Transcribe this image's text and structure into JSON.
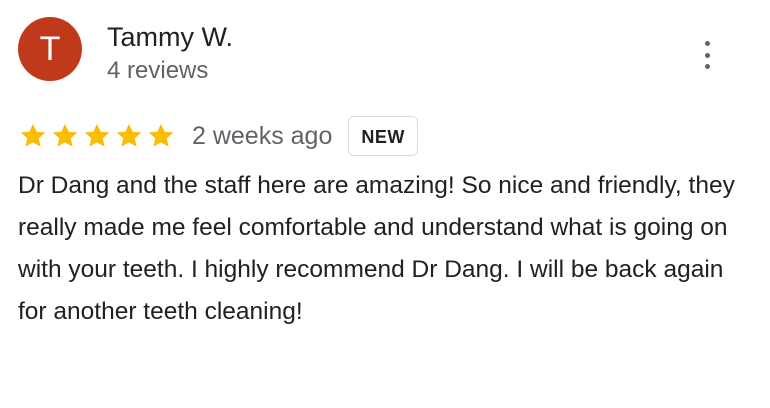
{
  "review": {
    "author": {
      "initial": "T",
      "name": "Tammy W.",
      "reviews_count": "4 reviews",
      "avatar_color": "#c0391b"
    },
    "rating": {
      "stars": 5,
      "max_stars": 5,
      "star_color": "#fbbc04"
    },
    "date": "2 weeks ago",
    "badge": "NEW",
    "text": "Dr Dang and the staff here are amazing! So nice and friendly, they really made me feel comfortable and understand what is going on with your teeth. I highly recommend Dr Dang. I will be back again for another teeth cleaning!",
    "menu_icon": "more-vertical-icon"
  }
}
